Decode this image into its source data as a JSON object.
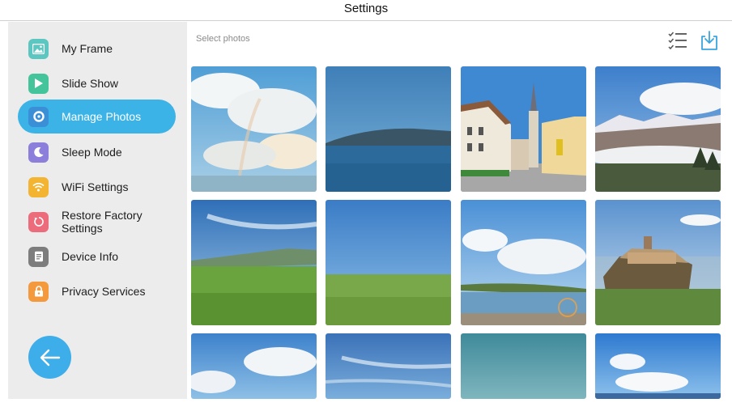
{
  "window": {
    "title": "Settings"
  },
  "sidebar": {
    "items": [
      {
        "label": "My Frame",
        "icon": "image-icon",
        "color": "#5cc7c0",
        "active": false
      },
      {
        "label": "Slide Show",
        "icon": "play-icon",
        "color": "#43c49a",
        "active": false
      },
      {
        "label": "Manage Photos",
        "icon": "photo-manage-icon",
        "color": "#3a8fd6",
        "active": true
      },
      {
        "label": "Sleep Mode",
        "icon": "moon-icon",
        "color": "#8c7fdc",
        "active": false
      },
      {
        "label": "WiFi Settings",
        "icon": "wifi-icon",
        "color": "#f2b431",
        "active": false
      },
      {
        "label": "Restore Factory Settings",
        "icon": "restore-icon",
        "color": "#ec6c7c",
        "active": false
      },
      {
        "label": "Device Info",
        "icon": "info-icon",
        "color": "#7d7d7d",
        "active": false
      },
      {
        "label": "Privacy Services",
        "icon": "lock-icon",
        "color": "#f59a3c",
        "active": false
      }
    ],
    "back_icon": "arrow-left-icon",
    "accent": "#3bb3e6"
  },
  "main": {
    "select_label": "Select photos",
    "toolbar": {
      "select_all_icon": "checklist-icon",
      "download_icon": "download-icon"
    },
    "photos": [
      {
        "scene": "sky-clouds-rainbow"
      },
      {
        "scene": "lake-island"
      },
      {
        "scene": "town-street-church"
      },
      {
        "scene": "mountains-clouds"
      },
      {
        "scene": "green-meadow-hill"
      },
      {
        "scene": "green-plain"
      },
      {
        "scene": "lake-shore-clouds"
      },
      {
        "scene": "hilltop-village"
      },
      {
        "scene": "blue-sky-clouds"
      },
      {
        "scene": "blue-sky-wisps"
      },
      {
        "scene": "teal-sky"
      },
      {
        "scene": "sky-cloud-horizon"
      }
    ]
  }
}
